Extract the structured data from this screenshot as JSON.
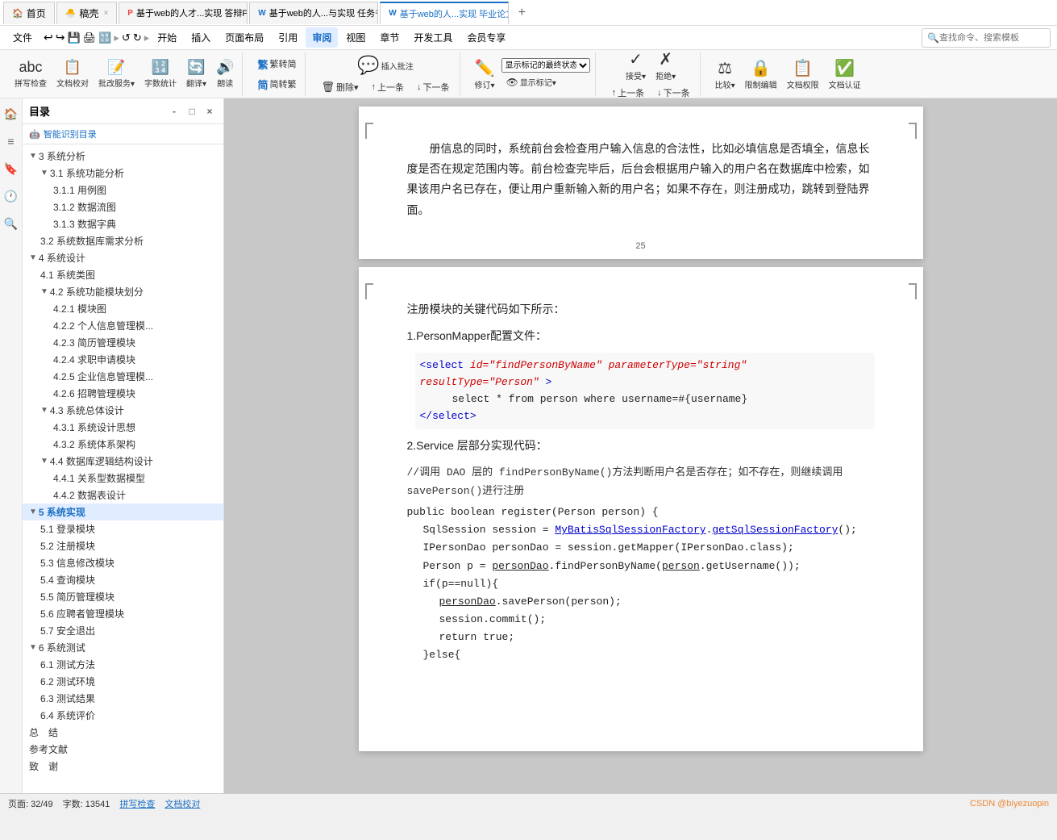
{
  "tabs": [
    {
      "id": "home",
      "label": "首页",
      "icon": "🏠",
      "active": false,
      "closable": false
    },
    {
      "id": "draft",
      "label": "稿壳",
      "icon": "📝",
      "active": false,
      "closable": true
    },
    {
      "id": "defense-ppt",
      "label": "基于web的人才...实现 答辩PPT",
      "icon": "W",
      "active": false,
      "closable": true
    },
    {
      "id": "task-book",
      "label": "基于web的人...与实现 任务书",
      "icon": "W",
      "active": false,
      "closable": true
    },
    {
      "id": "thesis",
      "label": "基于web的人...实现 毕业论文",
      "icon": "W",
      "active": true,
      "closable": true
    }
  ],
  "menu": {
    "items": [
      "文件",
      "开始",
      "插入",
      "页面布局",
      "引用",
      "审阅",
      "视图",
      "章节",
      "开发工具",
      "会员专享"
    ]
  },
  "ribbon": {
    "active_tab": "审阅",
    "tabs": [
      "开始",
      "插入",
      "页面布局",
      "引用",
      "审阅",
      "视图",
      "章节",
      "开发工具",
      "会员专享"
    ]
  },
  "toolbar": {
    "groups": [
      {
        "id": "proofing",
        "buttons": [
          {
            "id": "spell-check",
            "icon": "🔤",
            "label": "拼写检查"
          },
          {
            "id": "doc-compare",
            "icon": "📄",
            "label": "文档校对"
          },
          {
            "id": "batch-service",
            "icon": "🔧",
            "label": "批改服务"
          },
          {
            "id": "word-count",
            "icon": "🔢",
            "label": "字数统计"
          },
          {
            "id": "translate",
            "icon": "🔄",
            "label": "翻译"
          },
          {
            "id": "read-aloud",
            "icon": "🔊",
            "label": "朗读"
          },
          {
            "id": "trad-simp",
            "icon": "繁",
            "label": "繁转简"
          },
          {
            "id": "simp-trad",
            "icon": "简",
            "label": "简转繁"
          }
        ]
      },
      {
        "id": "comments",
        "buttons": [
          {
            "id": "insert-comment",
            "icon": "💬",
            "label": "插入批注"
          },
          {
            "id": "delete-comment",
            "icon": "🗑",
            "label": "删除"
          },
          {
            "id": "prev-comment",
            "icon": "↑",
            "label": "上一条"
          },
          {
            "id": "next-comment",
            "icon": "↓",
            "label": "下一条"
          }
        ]
      },
      {
        "id": "track",
        "buttons": [
          {
            "id": "modify",
            "icon": "✏️",
            "label": "修订"
          },
          {
            "id": "show-markup",
            "icon": "👁",
            "label": "显示标记"
          }
        ],
        "dropdown": "显示标记的最终状态"
      },
      {
        "id": "accept-reject",
        "buttons": [
          {
            "id": "accept",
            "icon": "✓",
            "label": "接受"
          },
          {
            "id": "reject",
            "icon": "✗",
            "label": "拒绝"
          },
          {
            "id": "prev-change",
            "icon": "↑",
            "label": "上一条"
          },
          {
            "id": "next-change",
            "icon": "↓",
            "label": "下一条"
          }
        ]
      },
      {
        "id": "compare",
        "buttons": [
          {
            "id": "compare",
            "icon": "⚖",
            "label": "比较"
          },
          {
            "id": "restrict",
            "icon": "🔒",
            "label": "限制编辑"
          },
          {
            "id": "doc-limit",
            "icon": "📋",
            "label": "文档权限"
          },
          {
            "id": "doc-verify",
            "icon": "✅",
            "label": "文档认证"
          }
        ]
      }
    ],
    "search_placeholder": "查找命令、搜索模板"
  },
  "toc": {
    "title": "目录",
    "smart_label": "智能识别目录",
    "items": [
      {
        "level": 1,
        "text": "3 系统分析",
        "expanded": true,
        "indent": 0
      },
      {
        "level": 2,
        "text": "3.1 系统功能分析",
        "expanded": true,
        "indent": 1
      },
      {
        "level": 3,
        "text": "3.1.1 用例图",
        "indent": 2
      },
      {
        "level": 3,
        "text": "3.1.2 数据流图",
        "indent": 2
      },
      {
        "level": 3,
        "text": "3.1.3 数据字典",
        "indent": 2
      },
      {
        "level": 2,
        "text": "3.2 系统数据库需求分析",
        "indent": 1
      },
      {
        "level": 1,
        "text": "4 系统设计",
        "expanded": true,
        "indent": 0
      },
      {
        "level": 2,
        "text": "4.1 系统类图",
        "indent": 1
      },
      {
        "level": 2,
        "text": "4.2 系统功能模块划分",
        "expanded": true,
        "indent": 1
      },
      {
        "level": 3,
        "text": "4.2.1 模块图",
        "indent": 2
      },
      {
        "level": 3,
        "text": "4.2.2 个人信息管理模...",
        "indent": 2
      },
      {
        "level": 3,
        "text": "4.2.3 简历管理模块",
        "indent": 2
      },
      {
        "level": 3,
        "text": "4.2.4 求职申请模块",
        "indent": 2
      },
      {
        "level": 3,
        "text": "4.2.5 企业信息管理模...",
        "indent": 2
      },
      {
        "level": 3,
        "text": "4.2.6 招聘管理模块",
        "indent": 2
      },
      {
        "level": 2,
        "text": "4.3 系统总体设计",
        "expanded": true,
        "indent": 1
      },
      {
        "level": 3,
        "text": "4.3.1 系统设计思想",
        "indent": 2
      },
      {
        "level": 3,
        "text": "4.3.2 系统体系架构",
        "indent": 2
      },
      {
        "level": 2,
        "text": "4.4 数据库逻辑结构设计",
        "expanded": true,
        "indent": 1
      },
      {
        "level": 3,
        "text": "4.4.1 关系型数据模型",
        "indent": 2
      },
      {
        "level": 3,
        "text": "4.4.2 数据表设计",
        "indent": 2
      },
      {
        "level": 1,
        "text": "5 系统实现",
        "expanded": true,
        "indent": 0,
        "active": true
      },
      {
        "level": 2,
        "text": "5.1 登录模块",
        "indent": 1
      },
      {
        "level": 2,
        "text": "5.2 注册模块",
        "indent": 1
      },
      {
        "level": 2,
        "text": "5.3 信息修改模块",
        "indent": 1
      },
      {
        "level": 2,
        "text": "5.4 查询模块",
        "indent": 1
      },
      {
        "level": 2,
        "text": "5.5 简历管理模块",
        "indent": 1
      },
      {
        "level": 2,
        "text": "5.6 应聘者管理模块",
        "indent": 1
      },
      {
        "level": 2,
        "text": "5.7 安全退出",
        "indent": 1
      },
      {
        "level": 1,
        "text": "6 系统测试",
        "expanded": true,
        "indent": 0
      },
      {
        "level": 2,
        "text": "6.1 测试方法",
        "indent": 1
      },
      {
        "level": 2,
        "text": "6.2 测试环境",
        "indent": 1
      },
      {
        "level": 2,
        "text": "6.3 测试结果",
        "indent": 1
      },
      {
        "level": 2,
        "text": "6.4 系统评价",
        "indent": 1
      },
      {
        "level": 1,
        "text": "总  结",
        "indent": 0
      },
      {
        "level": 1,
        "text": "参考文献",
        "indent": 0
      },
      {
        "level": 1,
        "text": "致  谢",
        "indent": 0
      }
    ]
  },
  "page1": {
    "page_number": "25",
    "content": "册信息的同时，系统前台会检查用户输入信息的合法性，比如必填信息是否填全，信息长度是否在规定范围内等。前台检查完毕后，后台会根据用户输入的用户名在数据库中检索，如果该用户名已存在，便让用户重新输入新的用户名；如果不存在，则注册成功，跳转到登陆界面。"
  },
  "page2": {
    "section_intro": "注册模块的关键代码如下所示：",
    "step1_label": "1.PersonMapper配置文件：",
    "xml_code": {
      "line1_open": "<select id=\"findPersonByName\" parameterType=\"string\" resultType=\"Person\">",
      "line2": "    select * from person where username=#{username}",
      "line3_close": "</select>"
    },
    "step2_label": "2.Service 层部分实现代码：",
    "comment_line": "//调用 DAO 层的 findPersonByName()方法判断用户名是否存在；如不存在，则继续调用 savePerson()进行注册",
    "code_lines": [
      "public boolean register(Person person) {",
      "    SqlSession session = MyBatisSqlSessionFactory.getSqlSessionFactory();",
      "    IPersonDao personDao = session.getMapper(IPersonDao.class);",
      "    Person p = personDao.findPersonByName(person.getUsername());",
      "    if(p==null){",
      "        personDao.savePerson(person);",
      "        session.commit();",
      "        return true;",
      "    }else{"
    ]
  },
  "status_bar": {
    "page_info": "页面: 32/49",
    "word_count": "字数: 13541",
    "spell_check": "拼写检查",
    "doc_verify": "文档校对",
    "csdn_user": "CSDN @biyezuopin"
  }
}
